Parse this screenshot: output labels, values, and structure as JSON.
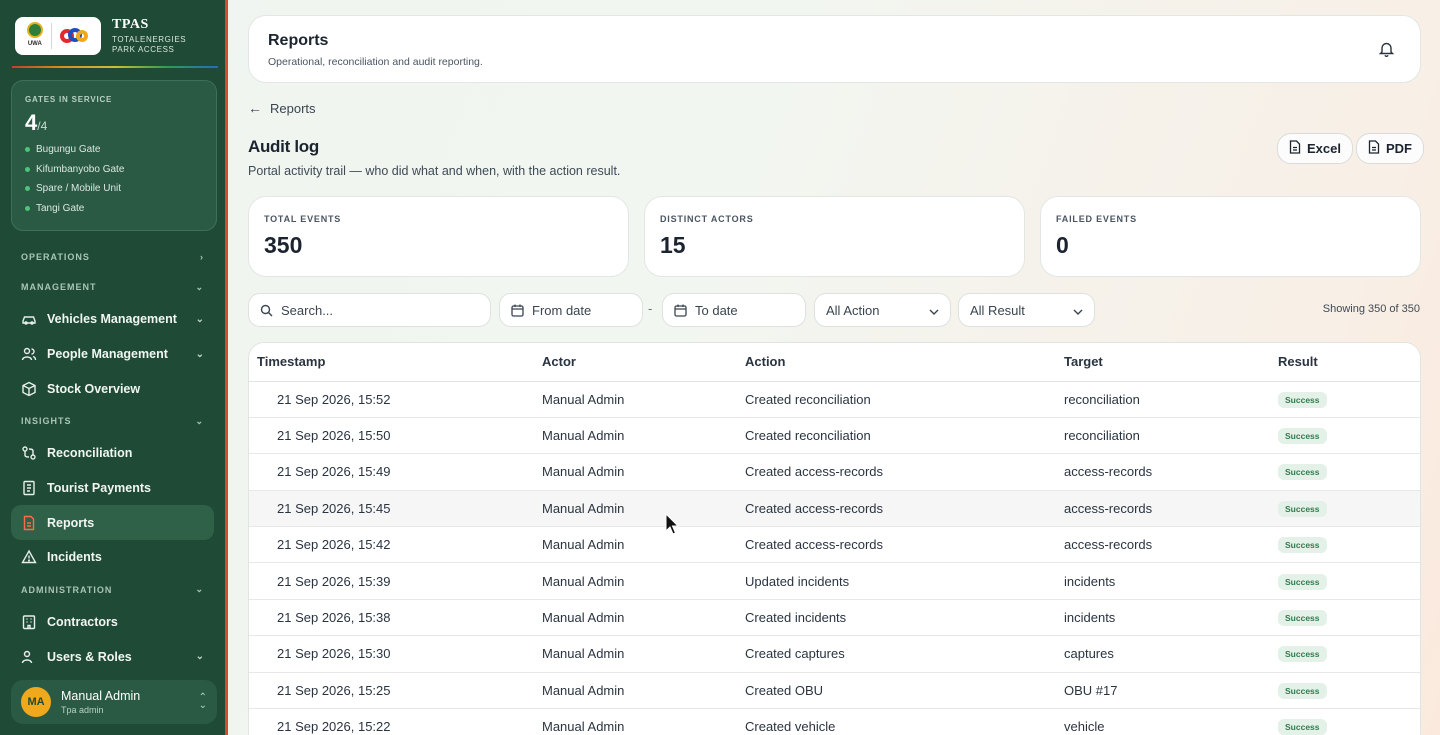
{
  "brand": {
    "uwa_logo_text": "UWA",
    "title": "TPAS",
    "subtitle": "TOTALENERGIES PARK ACCESS"
  },
  "gates": {
    "label": "GATES IN SERVICE",
    "in_service": "4",
    "total": "/4",
    "list": [
      "Bugungu Gate",
      "Kifumbanyobo Gate",
      "Spare / Mobile Unit",
      "Tangi Gate"
    ],
    "status_color": "#4fc27c"
  },
  "nav": {
    "operations": "OPERATIONS",
    "management": "MANAGEMENT",
    "vehicles": "Vehicles Management",
    "people": "People Management",
    "stock": "Stock Overview",
    "insights": "INSIGHTS",
    "reconciliation": "Reconciliation",
    "tourist_payments": "Tourist Payments",
    "reports": "Reports",
    "incidents": "Incidents",
    "administration": "ADMINISTRATION",
    "contractors": "Contractors",
    "users_roles": "Users & Roles"
  },
  "user": {
    "initials": "MA",
    "name": "Manual Admin",
    "role": "Tpa admin"
  },
  "header": {
    "title": "Reports",
    "subtitle": "Operational, reconciliation and audit reporting."
  },
  "back_label": "Reports",
  "page": {
    "title": "Audit log",
    "description": "Portal activity trail — who did what and when, with the action result."
  },
  "exports": {
    "excel": "Excel",
    "pdf": "PDF"
  },
  "stats": [
    {
      "label": "TOTAL EVENTS",
      "value": "350"
    },
    {
      "label": "DISTINCT ACTORS",
      "value": "15"
    },
    {
      "label": "FAILED EVENTS",
      "value": "0"
    }
  ],
  "filters": {
    "search_placeholder": "Search...",
    "from_date": "From date",
    "range_sep": "-",
    "to_date": "To date",
    "action": "All Action",
    "result": "All Result",
    "showing": "Showing 350 of 350"
  },
  "table": {
    "headers": [
      "Timestamp",
      "Actor",
      "Action",
      "Target",
      "Result"
    ],
    "rows": [
      [
        "21 Sep 2026, 15:52",
        "Manual Admin",
        "Created reconciliation",
        "reconciliation",
        "Success"
      ],
      [
        "21 Sep 2026, 15:50",
        "Manual Admin",
        "Created reconciliation",
        "reconciliation",
        "Success"
      ],
      [
        "21 Sep 2026, 15:49",
        "Manual Admin",
        "Created access-records",
        "access-records",
        "Success"
      ],
      [
        "21 Sep 2026, 15:45",
        "Manual Admin",
        "Created access-records",
        "access-records",
        "Success"
      ],
      [
        "21 Sep 2026, 15:42",
        "Manual Admin",
        "Created access-records",
        "access-records",
        "Success"
      ],
      [
        "21 Sep 2026, 15:39",
        "Manual Admin",
        "Updated incidents",
        "incidents",
        "Success"
      ],
      [
        "21 Sep 2026, 15:38",
        "Manual Admin",
        "Created incidents",
        "incidents",
        "Success"
      ],
      [
        "21 Sep 2026, 15:30",
        "Manual Admin",
        "Created captures",
        "captures",
        "Success"
      ],
      [
        "21 Sep 2026, 15:25",
        "Manual Admin",
        "Created OBU",
        "OBU #17",
        "Success"
      ],
      [
        "21 Sep 2026, 15:22",
        "Manual Admin",
        "Created vehicle",
        "vehicle",
        "Success"
      ]
    ]
  },
  "colors": {
    "sidebar": "#1f4a35",
    "accent": "#d94a2b",
    "success_bg": "#e4f1e8",
    "success_text": "#2f7c4e"
  }
}
